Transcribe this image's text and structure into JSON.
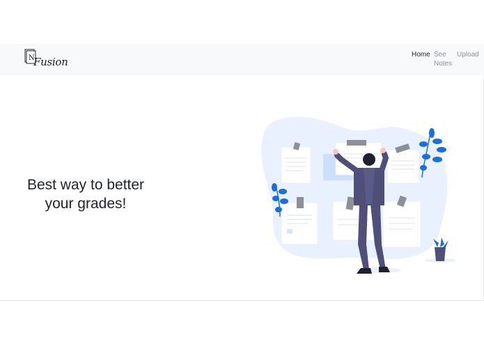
{
  "navbar": {
    "brand": {
      "initial": "N",
      "name": "Fusion"
    },
    "links": [
      {
        "label": "Home",
        "active": true
      },
      {
        "label": "See Notes",
        "active": false
      },
      {
        "label": "Upload",
        "active": false
      }
    ]
  },
  "hero": {
    "headline": "Best way to better your grades!",
    "illustration": "person-pinning-notes-illustration"
  },
  "colors": {
    "navbar_bg": "#f8f9fa",
    "accent_blue": "#1a6fe0",
    "blob": "#e8f1fd",
    "suit": "#4f4f7a",
    "text_dark": "#212529",
    "text_muted": "#8a8f94"
  }
}
